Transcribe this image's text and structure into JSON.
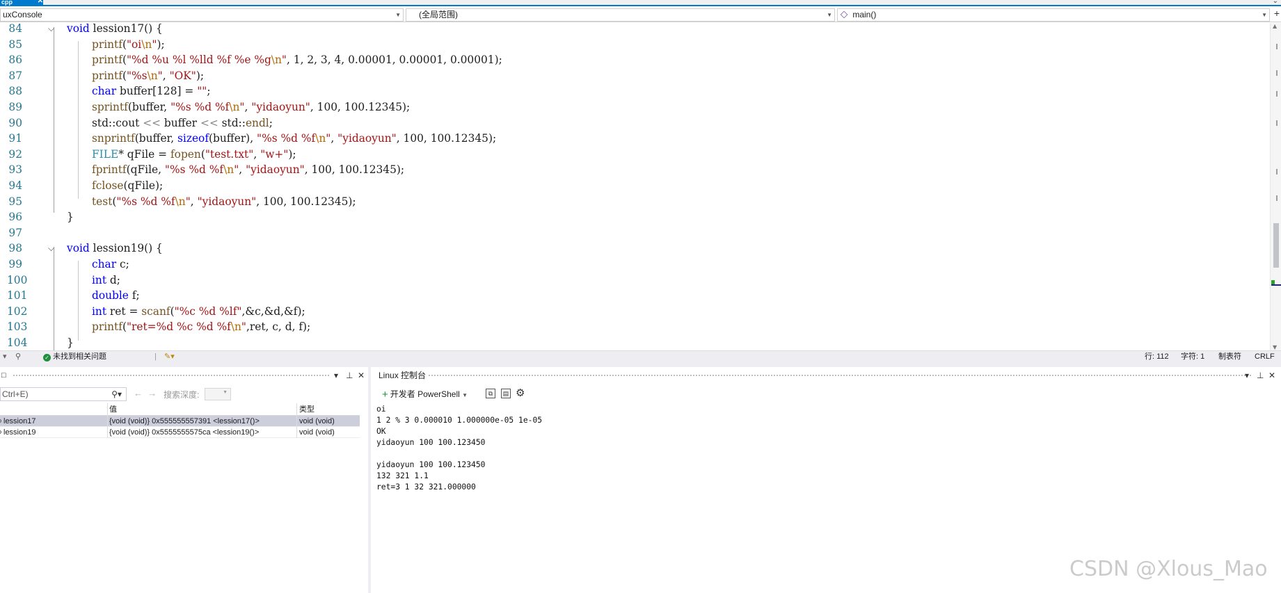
{
  "file_tab": {
    "name": "cpp",
    "close": "✕"
  },
  "navbar": {
    "project": "uxConsole",
    "scope": "(全局范围)",
    "member": "main()",
    "add": "+"
  },
  "code_lines": [
    {
      "n": "84",
      "fold": true,
      "segs": [
        [
          "kw",
          "void "
        ],
        [
          "pl",
          "lession17() {"
        ]
      ]
    },
    {
      "n": "85",
      "indent": true,
      "segs": [
        [
          "fn",
          "printf"
        ],
        [
          "pl",
          "("
        ],
        [
          "str",
          "\"oi"
        ],
        [
          "esc",
          "\\n"
        ],
        [
          "str",
          "\""
        ],
        [
          "pl",
          ");"
        ]
      ]
    },
    {
      "n": "86",
      "indent": true,
      "segs": [
        [
          "fn",
          "printf"
        ],
        [
          "pl",
          "("
        ],
        [
          "str",
          "\"%d %u %l %lld %f %e %g"
        ],
        [
          "esc",
          "\\n"
        ],
        [
          "str",
          "\""
        ],
        [
          "pl",
          ", 1, 2, 3, 4, 0.00001, 0.00001, 0.00001);"
        ]
      ]
    },
    {
      "n": "87",
      "indent": true,
      "segs": [
        [
          "fn",
          "printf"
        ],
        [
          "pl",
          "("
        ],
        [
          "str",
          "\"%s"
        ],
        [
          "esc",
          "\\n"
        ],
        [
          "str",
          "\""
        ],
        [
          "pl",
          ", "
        ],
        [
          "str",
          "\"OK\""
        ],
        [
          "pl",
          ");"
        ]
      ]
    },
    {
      "n": "88",
      "indent": true,
      "segs": [
        [
          "kw",
          "char "
        ],
        [
          "pl",
          "buffer[128] = "
        ],
        [
          "str",
          "\"\""
        ],
        [
          "pl",
          ";"
        ]
      ]
    },
    {
      "n": "89",
      "indent": true,
      "segs": [
        [
          "fn",
          "sprintf"
        ],
        [
          "pl",
          "(buffer, "
        ],
        [
          "str",
          "\"%s %d %f"
        ],
        [
          "esc",
          "\\n"
        ],
        [
          "str",
          "\""
        ],
        [
          "pl",
          ", "
        ],
        [
          "str",
          "\"yidaoyun\""
        ],
        [
          "pl",
          ", 100, 100.12345);"
        ]
      ]
    },
    {
      "n": "90",
      "indent": true,
      "segs": [
        [
          "pl",
          "std::cout "
        ],
        [
          "fmt",
          "<<"
        ],
        [
          "pl",
          " buffer "
        ],
        [
          "fmt",
          "<<"
        ],
        [
          "pl",
          " std::"
        ],
        [
          "fn",
          "endl"
        ],
        [
          "pl",
          ";"
        ]
      ]
    },
    {
      "n": "91",
      "indent": true,
      "segs": [
        [
          "fn",
          "snprintf"
        ],
        [
          "pl",
          "(buffer, "
        ],
        [
          "kw",
          "sizeof"
        ],
        [
          "pl",
          "(buffer), "
        ],
        [
          "str",
          "\"%s %d %f"
        ],
        [
          "esc",
          "\\n"
        ],
        [
          "str",
          "\""
        ],
        [
          "pl",
          ", "
        ],
        [
          "str",
          "\"yidaoyun\""
        ],
        [
          "pl",
          ", 100, 100.12345);"
        ]
      ]
    },
    {
      "n": "92",
      "indent": true,
      "segs": [
        [
          "ty",
          "FILE"
        ],
        [
          "pl",
          "* qFile = "
        ],
        [
          "fn",
          "fopen"
        ],
        [
          "pl",
          "("
        ],
        [
          "str",
          "\"test.txt\""
        ],
        [
          "pl",
          ", "
        ],
        [
          "str",
          "\"w+\""
        ],
        [
          "pl",
          ");"
        ]
      ]
    },
    {
      "n": "93",
      "indent": true,
      "segs": [
        [
          "fn",
          "fprintf"
        ],
        [
          "pl",
          "(qFile, "
        ],
        [
          "str",
          "\"%s %d %f"
        ],
        [
          "esc",
          "\\n"
        ],
        [
          "str",
          "\""
        ],
        [
          "pl",
          ", "
        ],
        [
          "str",
          "\"yidaoyun\""
        ],
        [
          "pl",
          ", 100, 100.12345);"
        ]
      ]
    },
    {
      "n": "94",
      "indent": true,
      "segs": [
        [
          "fn",
          "fclose"
        ],
        [
          "pl",
          "(qFile);"
        ]
      ]
    },
    {
      "n": "95",
      "indent": true,
      "segs": [
        [
          "fn",
          "test"
        ],
        [
          "pl",
          "("
        ],
        [
          "str",
          "\"%s %d %f"
        ],
        [
          "esc",
          "\\n"
        ],
        [
          "str",
          "\""
        ],
        [
          "pl",
          ", "
        ],
        [
          "str",
          "\"yidaoyun\""
        ],
        [
          "pl",
          ", 100, 100.12345);"
        ]
      ]
    },
    {
      "n": "96",
      "segs": [
        [
          "pl",
          "}"
        ]
      ]
    },
    {
      "n": "97",
      "segs": []
    },
    {
      "n": "98",
      "fold": true,
      "segs": [
        [
          "kw",
          "void "
        ],
        [
          "pl",
          "lession19() {"
        ]
      ]
    },
    {
      "n": "99",
      "indent": true,
      "segs": [
        [
          "kw",
          "char "
        ],
        [
          "pl",
          "c;"
        ]
      ]
    },
    {
      "n": "100",
      "indent": true,
      "segs": [
        [
          "kw",
          "int "
        ],
        [
          "pl",
          "d;"
        ]
      ]
    },
    {
      "n": "101",
      "indent": true,
      "segs": [
        [
          "kw",
          "double "
        ],
        [
          "pl",
          "f;"
        ]
      ]
    },
    {
      "n": "102",
      "indent": true,
      "segs": [
        [
          "kw",
          "int "
        ],
        [
          "pl",
          "ret = "
        ],
        [
          "fn",
          "scanf"
        ],
        [
          "pl",
          "("
        ],
        [
          "str",
          "\"%c %d %lf\""
        ],
        [
          "pl",
          ",&c,&d,&f);"
        ]
      ]
    },
    {
      "n": "103",
      "indent": true,
      "segs": [
        [
          "fn",
          "printf"
        ],
        [
          "pl",
          "("
        ],
        [
          "str",
          "\"ret=%d %c %d %f"
        ],
        [
          "esc",
          "\\n"
        ],
        [
          "str",
          "\""
        ],
        [
          "pl",
          ",ret, c, d, f);"
        ]
      ]
    },
    {
      "n": "104",
      "segs": [
        [
          "pl",
          "}"
        ]
      ]
    }
  ],
  "status": {
    "issues": "未找到相关问题",
    "line": "行: 112",
    "char": "字符: 1",
    "tabs": "制表符",
    "eol": "CRLF"
  },
  "watch": {
    "search_placeholder": "Ctrl+E)",
    "search_depth_label": "搜索深度:",
    "columns": {
      "name": "",
      "value": "值",
      "type": "类型"
    },
    "rows": [
      {
        "name": "lession17",
        "value": "{void (void)} 0x555555557391 <lession17()>",
        "type": "void (void)",
        "selected": true
      },
      {
        "name": "lession19",
        "value": "{void (void)} 0x5555555575ca <lession19()>",
        "type": "void (void)",
        "selected": false
      }
    ]
  },
  "console": {
    "title": "Linux 控制台",
    "new_terminal_label": "开发者 PowerShell",
    "output": "oi\n1 2 % 3 0.000010 1.000000e-05 1e-05\nOK\nyidaoyun 100 100.123450\n\nyidaoyun 100 100.123450\n132 321 1.1\nret=3 1 32 321.000000"
  },
  "panel_controls": {
    "dropdown": "▾",
    "pin": "⊥",
    "close": "✕"
  },
  "watermark": "CSDN @Xlous_Mao"
}
